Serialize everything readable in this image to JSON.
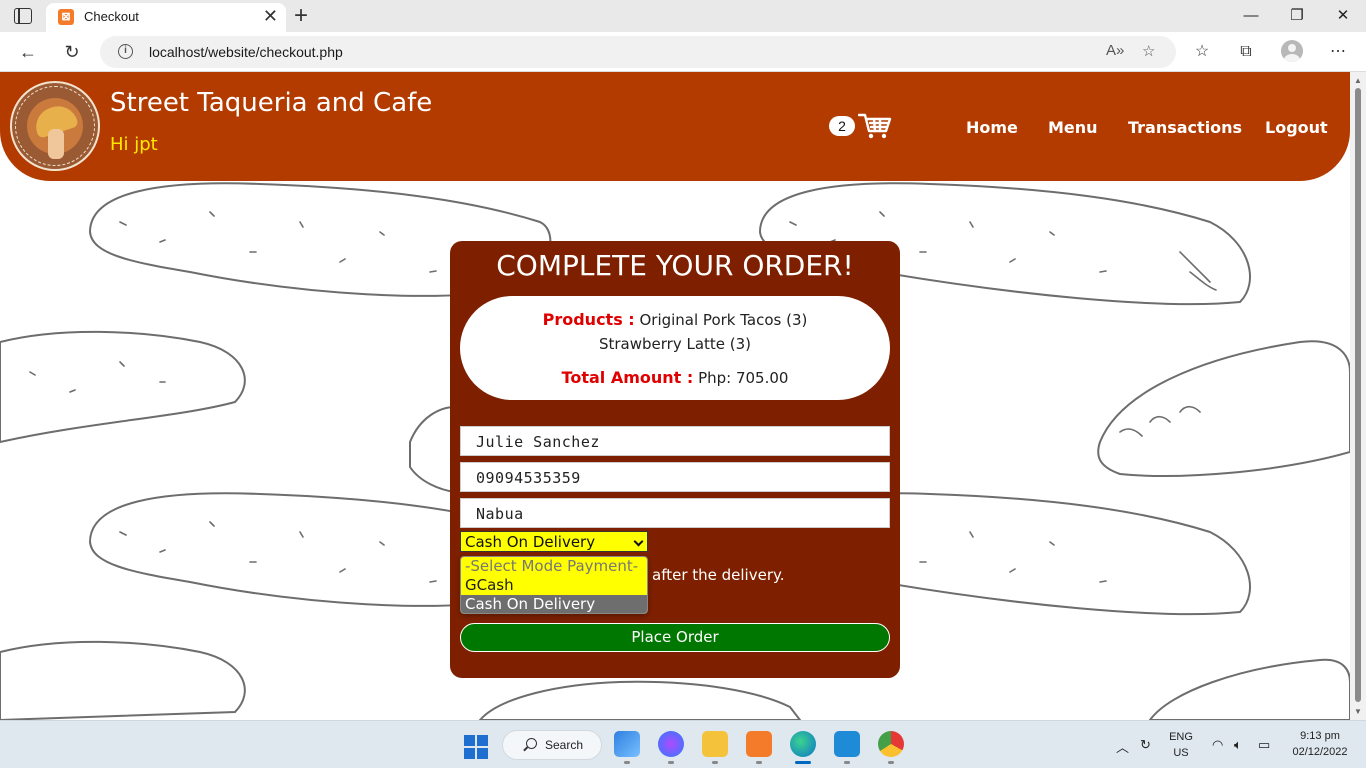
{
  "browser": {
    "tab_title": "Checkout",
    "tab_close": "✕",
    "new_tab": "+",
    "url": "localhost/website/checkout.php",
    "window_controls": {
      "minimize": "—",
      "maximize": "❐",
      "close": "✕"
    },
    "icons": [
      "sidebar-toggle-icon",
      "xampp-favicon-icon",
      "back-icon",
      "refresh-icon",
      "info-icon",
      "read-aloud-icon",
      "favorite-add-icon",
      "favorites-icon",
      "collections-icon",
      "profile-icon",
      "more-icon"
    ]
  },
  "header": {
    "site_name": "Street Taqueria and Cafe",
    "greeting": "Hi jpt",
    "cart_count": "2",
    "nav": [
      "Home",
      "Menu",
      "Transactions",
      "Logout"
    ],
    "colors": {
      "header_bg": "#b33b00",
      "greeting": "#ffe800"
    }
  },
  "checkout": {
    "title": "COMPLETE YOUR ORDER!",
    "products_label": "Products :",
    "products": [
      "Original Pork Tacos (3)",
      "Strawberry Latte (3)"
    ],
    "total_label": "Total Amount :",
    "total_value": "Php: 705.00",
    "name": "Julie Sanchez",
    "phone": "09094535359",
    "address": "Nabua",
    "payment_selected": "Cash On Delivery",
    "payment_options": [
      "-Select Mode Payment-",
      "GCash",
      "Cash On Delivery"
    ],
    "note": "after the delivery.",
    "place_order": "Place Order",
    "colors": {
      "card_bg": "#7e2000",
      "label_red": "#e00000",
      "select_bg": "#ffff00",
      "button_bg": "#007700"
    }
  },
  "taskbar": {
    "search": "Search",
    "apps": [
      "start-icon",
      "photos-icon",
      "messenger-icon",
      "file-explorer-icon",
      "xampp-icon",
      "edge-icon",
      "vscode-icon",
      "chrome-icon"
    ],
    "lang_top": "ENG",
    "lang_bottom": "US",
    "time": "9:13 pm",
    "date": "02/12/2022"
  }
}
